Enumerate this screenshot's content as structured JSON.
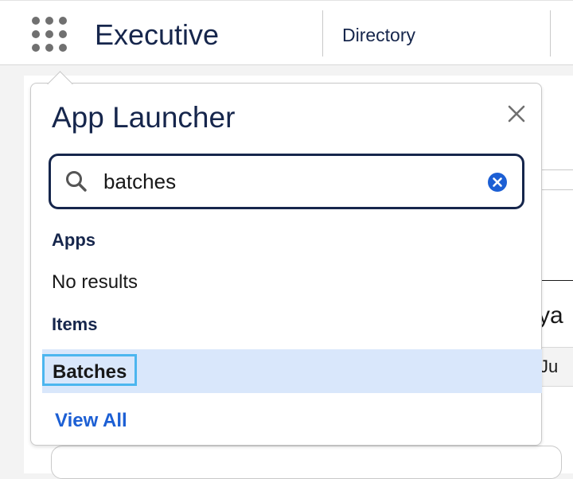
{
  "header": {
    "app_name": "Executive",
    "tabs": [
      {
        "label": "Directory"
      }
    ]
  },
  "background": {
    "partial_text_1": "ya",
    "partial_text_2": "Ju"
  },
  "app_launcher": {
    "title": "App Launcher",
    "search": {
      "value": "batches"
    },
    "apps_section": {
      "label": "Apps",
      "empty_text": "No results"
    },
    "items_section": {
      "label": "Items",
      "results": [
        {
          "label": "Batches"
        }
      ]
    },
    "view_all_label": "View All"
  },
  "colors": {
    "navy": "#16264c",
    "accent_blue": "#1c5fd4",
    "focus_ring": "#4cb6ef",
    "selected_row": "#d9e7fb"
  },
  "icons": {
    "launcher": "waffle-icon",
    "close": "close-icon",
    "search": "search-icon",
    "clear": "clear-icon"
  }
}
